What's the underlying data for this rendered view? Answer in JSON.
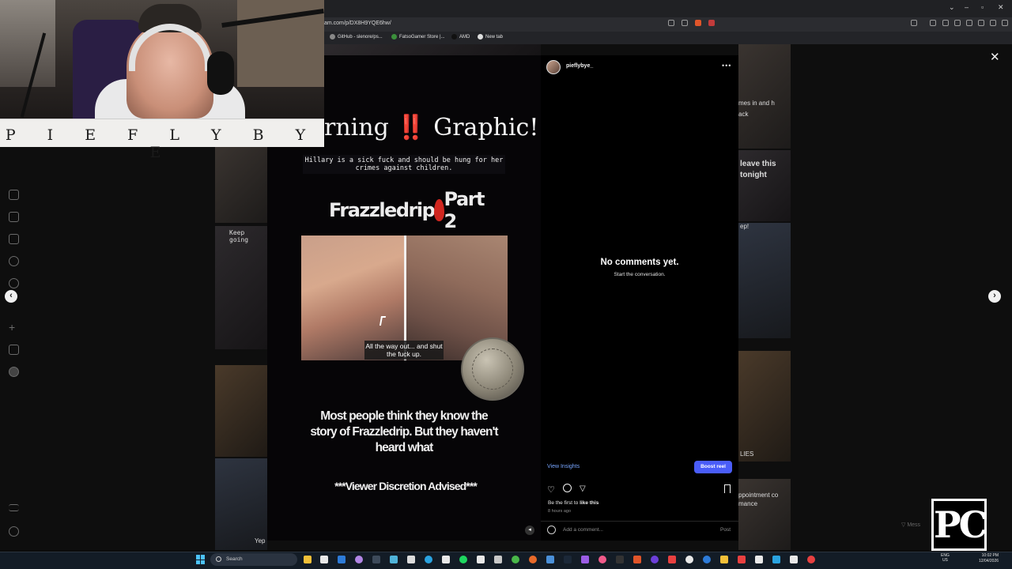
{
  "browser": {
    "url": "am.com/p/DX8H9YQE6hw/",
    "bookmarks": [
      {
        "label": "GitHub - slenore/ps..."
      },
      {
        "label": "FatsoGamer Store |..."
      },
      {
        "label": "AMD"
      },
      {
        "label": "New tab"
      }
    ]
  },
  "overlay": {
    "streamer_name": "P I E F L Y B Y E",
    "brand_logo": "PC"
  },
  "background_tiles": {
    "left_caption": "Keep going",
    "left_bottom": "Yep",
    "right_texts": [
      "mes in and h",
      "ack",
      "leave this",
      "tonight",
      "ep!",
      "LIES",
      "ppointment co",
      "mance"
    ]
  },
  "reel": {
    "warning_prefix": "rning",
    "warning_bang": "‼️",
    "warning_suffix": "Graphic!!",
    "banner_text": "Hillary is a sick fuck and should be hung for her crimes against children.",
    "title_left": "Frazzledrip",
    "title_right": "Part 2",
    "image_caption": "All the way out... and shut the fuck up.",
    "body_text": "Most people think they know the story of Frazzledrip. But they haven't heard what",
    "advisory": "***Viewer Discretion Advised***"
  },
  "comments_panel": {
    "username": "pieflybye_",
    "more_icon": "•••",
    "empty_title": "No comments yet.",
    "empty_subtitle": "Start the conversation.",
    "view_insights": "View Insights",
    "boost_button": "Boost reel",
    "likes_text_prefix": "Be the first to",
    "likes_text_bold": "like this",
    "timestamp": "8 hours ago",
    "comment_placeholder": "Add a comment...",
    "post_button": "Post"
  },
  "taskbar": {
    "search_label": "Search",
    "lang_top": "ENG",
    "lang_bottom": "US",
    "time": "10:02 PM",
    "date": "12/04/2026"
  },
  "colors": {
    "accent_blue": "#4a5df9",
    "link_blue": "#78a6ff",
    "warning_red": "#e0322a"
  },
  "icons": [
    "home-icon",
    "reels-icon",
    "send-icon",
    "search-icon",
    "explore-icon",
    "create-icon",
    "menu-icon",
    "heart-icon",
    "comment-icon",
    "share-icon",
    "bookmark-icon",
    "close-icon",
    "chevron-left-icon",
    "chevron-right-icon"
  ]
}
